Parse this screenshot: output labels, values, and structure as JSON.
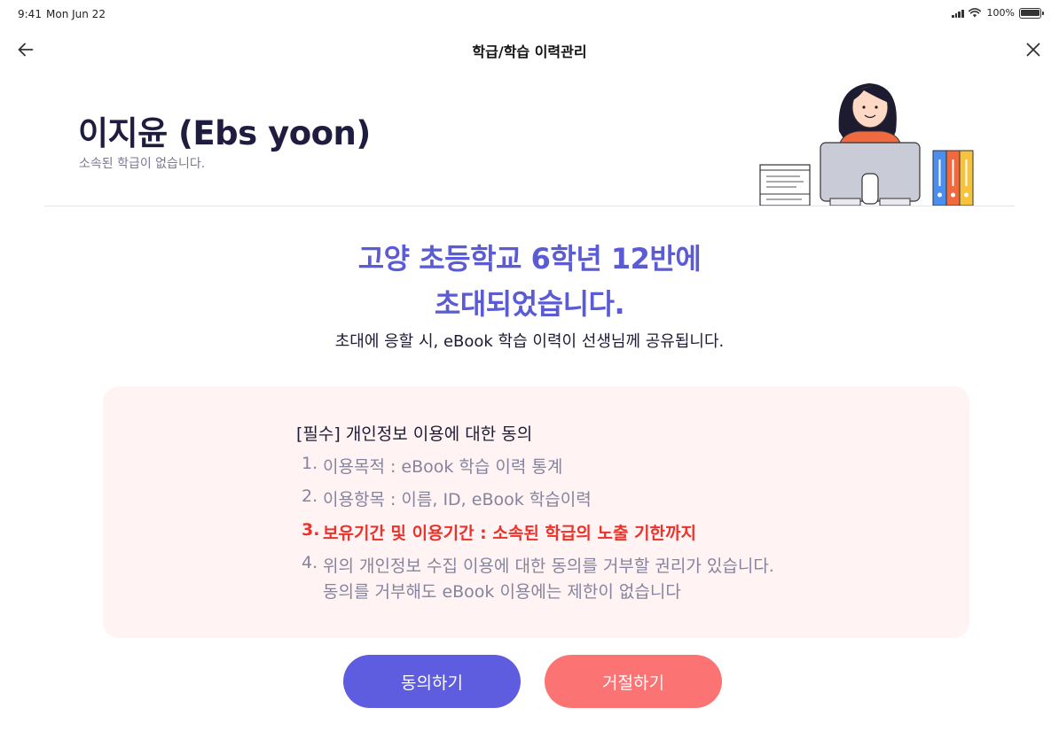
{
  "status_bar": {
    "time": "9:41",
    "date": "Mon Jun 22",
    "battery": "100%"
  },
  "nav": {
    "title": "학급/학습 이력관리",
    "back_icon": "arrow-left-icon",
    "close_icon": "close-icon"
  },
  "user": {
    "name": "이지윤 (Ebs yoon)",
    "status": "소속된 학급이 없습니다."
  },
  "invitation": {
    "title_line1": "고양 초등학교 6학년 12반에",
    "title_line2": "초대되었습니다.",
    "description": "초대에 응할 시, eBook  학습 이력이 선생님께 공유됩니다."
  },
  "consent": {
    "heading": "[필수] 개인정보 이용에 대한 동의",
    "items": [
      {
        "num": "1.",
        "text": "이용목적 : eBook 학습 이력 통계"
      },
      {
        "num": "2.",
        "text": "이용항목 :  이름, ID, eBook 학습이력"
      },
      {
        "num": "3.",
        "text": "보유기간 및 이용기간 :  소속된 학급의 노출 기한까지"
      },
      {
        "num": "4.",
        "text": "위의 개인정보 수집 이용에 대한 동의를 거부할 권리가 있습니다.",
        "text2": "동의를 거부해도 eBook 이용에는 제한이 없습니다"
      }
    ]
  },
  "buttons": {
    "agree": "동의하기",
    "reject": "거절하기"
  },
  "colors": {
    "accent": "#5f5ddf",
    "title": "#5b5bd6",
    "reject": "#fb7373",
    "warning_text": "#e8342c",
    "consent_bg": "#fff3f3"
  }
}
